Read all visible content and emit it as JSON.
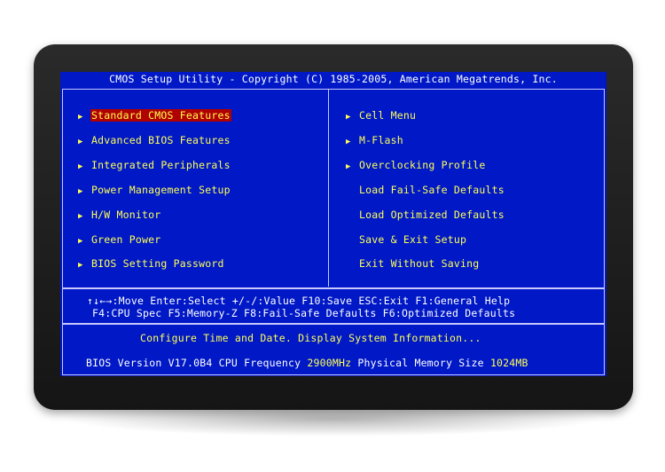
{
  "title": "CMOS Setup Utility - Copyright (C) 1985-2005, American Megatrends, Inc.",
  "left_menu": [
    {
      "label": "Standard CMOS Features",
      "arrow": "▶",
      "selected": true
    },
    {
      "label": "Advanced BIOS Features",
      "arrow": "▶",
      "selected": false
    },
    {
      "label": "Integrated Peripherals",
      "arrow": "▶",
      "selected": false
    },
    {
      "label": "Power Management Setup",
      "arrow": "▶",
      "selected": false
    },
    {
      "label": "H/W Monitor",
      "arrow": "▶",
      "selected": false
    },
    {
      "label": "Green Power",
      "arrow": "▶",
      "selected": false
    },
    {
      "label": "BIOS Setting Password",
      "arrow": "▶",
      "selected": false
    }
  ],
  "right_menu": [
    {
      "label": "Cell Menu",
      "arrow": "▶"
    },
    {
      "label": "M-Flash",
      "arrow": "▶"
    },
    {
      "label": "Overclocking Profile",
      "arrow": "▶"
    },
    {
      "label": "Load Fail-Safe Defaults",
      "arrow": ""
    },
    {
      "label": "Load Optimized Defaults",
      "arrow": ""
    },
    {
      "label": "Save & Exit Setup",
      "arrow": ""
    },
    {
      "label": "Exit Without Saving",
      "arrow": ""
    }
  ],
  "keys": {
    "line1": "↑↓←→:Move  Enter:Select  +/-/:Value  F10:Save  ESC:Exit  F1:General Help",
    "line2": "F4:CPU Spec  F5:Memory-Z  F8:Fail-Safe Defaults    F6:Optimized Defaults"
  },
  "hint": "Configure Time and Date.  Display System Information...",
  "bios_info": {
    "version_label": "BIOS Version V17.0B4 CPU Frequency ",
    "cpu_frequency": "2900MHz",
    "memory_label": " Physical Memory Size ",
    "memory_size": "1024MB"
  },
  "colors": {
    "background": "#0018c6",
    "text": "#ffff55",
    "selection": "#b00000",
    "title_text": "#ffffff"
  }
}
